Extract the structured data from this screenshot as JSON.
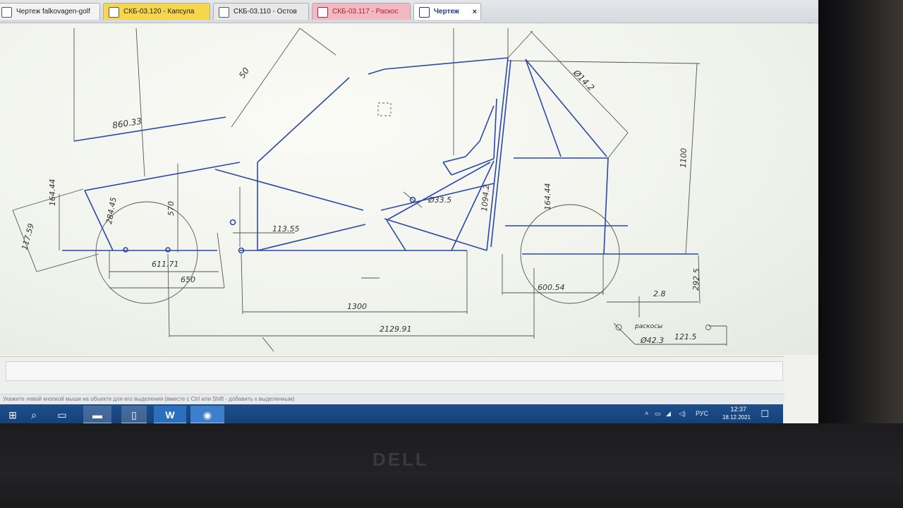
{
  "tabs": [
    {
      "label": "Чертеж falkovagen-golf",
      "active": false
    },
    {
      "label": "СКБ-03.120 - Капсула",
      "active": false
    },
    {
      "label": "СКБ-03.110 - Остов",
      "active": false
    },
    {
      "label": "СКБ-03.117 - Раскос",
      "active": false
    },
    {
      "label": "Чертеж",
      "active": true,
      "close": "×"
    }
  ],
  "tab_dropdown": "▼",
  "drawing": {
    "dimensions": {
      "d860": "860.33",
      "d50": "50",
      "d11759": "117.59",
      "d16444a": "164.44",
      "d28445": "284.45",
      "d570": "570",
      "d61171": "611.71",
      "d650": "650",
      "d11355": "113.55",
      "d1300": "1300",
      "d212991": "2129.91",
      "d335": "Ø33.5",
      "d10942": "1094.2",
      "d16444b": "164.44",
      "d60054": "600.54",
      "d1100": "1100",
      "d9142": "Ø14.2",
      "d2925": "292.5",
      "d28": "2.8",
      "d423": "Ø42.3",
      "d1215": "121.5",
      "note": "раскосы"
    }
  },
  "statusbar": "Укажите левой кнопкой мыши на объекте для его выделения (вместе с Ctrl или Shift - добавить к выделенным)",
  "taskbar": {
    "start_icon": "⊞",
    "search_icon": "⌕",
    "taskview_icon": "▭",
    "explorer_icon": "▬",
    "files_icon": "▯",
    "word_label": "W",
    "app_icon": "◉"
  },
  "tray": {
    "chevron": "˄",
    "network": "▭",
    "signal": "◢",
    "volume": "◁)",
    "language": "РУС",
    "time": "12:37",
    "date": "18.12.2021",
    "notifications": "☐"
  },
  "brand": "DELL",
  "colors": {
    "drawing_line": "#2a48a8",
    "dim_line": "#555555",
    "taskbar": "#1c4f8e"
  }
}
